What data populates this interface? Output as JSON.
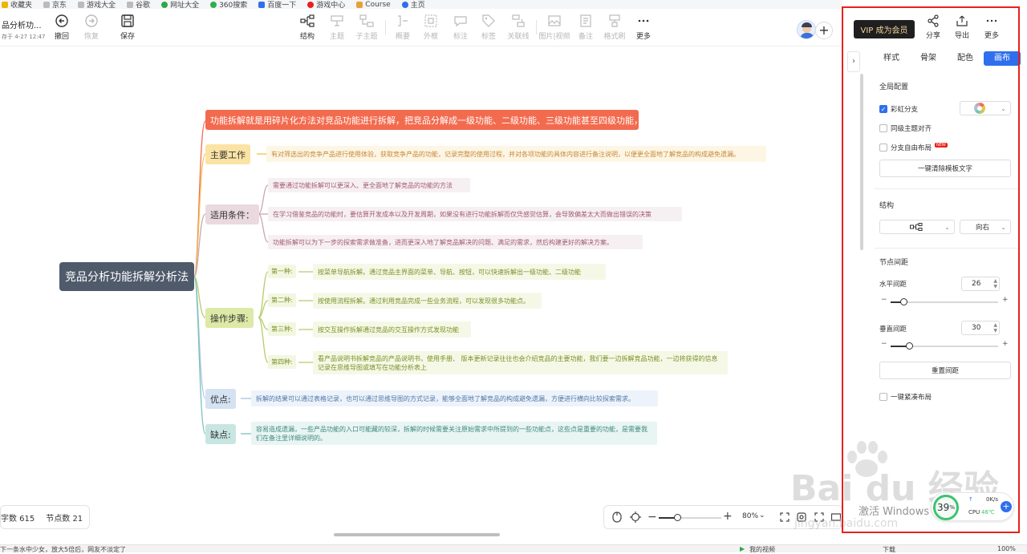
{
  "bookmarks": [
    "收藏夹",
    "京东",
    "游戏大全",
    "谷歌",
    "网址大全",
    "360搜索",
    "百度一下",
    "游戏中心",
    "Course",
    "主页"
  ],
  "doc": {
    "title": "品分析功...",
    "time": "存于 4-27 12:47"
  },
  "toolbar": {
    "undo": "撤回",
    "redo": "恢复",
    "save": "保存",
    "structure": "结构",
    "topic": "主题",
    "subtopic": "子主题",
    "summary": "概要",
    "frame": "外框",
    "annotation": "标注",
    "tag": "标签",
    "link": "关联线",
    "image_video": "图片|视频",
    "note": "备注",
    "format_brush": "格式刷",
    "more": "更多"
  },
  "mindmap": {
    "root": "竞品分析功能拆解分析法",
    "headline": "功能拆解就是用碎片化方法对竞品功能进行拆解，把竞品分解成一级功能、二级功能、三级功能甚至四级功能，",
    "main_work": {
      "label": "主要工作",
      "text": "有对筛选出的竞争产品进行使用体验，获取竞争产品的功能，记录完整的使用过程，并对各项功能的具体内容进行备注说明，以便更全面地了解竞品的构成避免遗漏。"
    },
    "conditions": {
      "label": "适用条件：",
      "items": [
        "需要通过功能拆解可以更深入、更全面地了解竞品的功能的方法",
        "在学习借鉴竞品的功能时，要估算开发成本以及开发周期，如果没有进行功能拆解而仅凭感觉估算，会导致偏差太大而做出错误的决策",
        "功能拆解可以为下一步的探索需求做准备，进而更深入地了解竞品解决的问题、满足的需求，然后构建更好的解决方案。"
      ]
    },
    "steps": {
      "label": "操作步骤:",
      "items": [
        {
          "tag": "第一种:",
          "text": "按菜单导航拆解。通过竞品主界面的菜单、导航、按钮，可以快速拆解出一级功能、二级功能"
        },
        {
          "tag": "第二种:",
          "text": "按使用流程拆解。通过利用竞品完成一些业务流程，可以发现很多功能点。"
        },
        {
          "tag": "第三种:",
          "text": "按交互操作拆解通过竞品的交互操作方式发现功能"
        },
        {
          "tag": "第四种:",
          "text": "看产品说明书拆解竞品的产品说明书，使用手册、 版本更新记录往往也会介绍竞品的主要功能，我们要一边拆解竞品功能，一边将获得的信息记录在思维导图或填写在功能分析表上"
        }
      ]
    },
    "pros": {
      "label": "优点:",
      "text": "拆解的结果可以通过表格记录，也可以通过思维导图的方式记录，能够全面地了解竞品的构成避免遗漏，方便进行横向比较探索需求。"
    },
    "cons": {
      "label": "缺点:",
      "text": "容易造成遗漏，一些产品功能的入口可能藏的较深，拆解的时候需要关注原始需求中所提到的一些功能点，这些点是重要的功能，是需要我们在备注里详细说明的。"
    }
  },
  "canvas_footer": {
    "word_count": "字数 615",
    "node_count": "节点数 21",
    "zoom": "80%",
    "zoom_level": 0.3
  },
  "panel": {
    "vip": "VIP 成为会员",
    "share": "分享",
    "export": "导出",
    "more": "更多",
    "tabs": [
      "样式",
      "骨架",
      "配色",
      "画布"
    ],
    "active_tab": 3,
    "global_config": "全局配置",
    "rainbow": "彩虹分支",
    "same_level_align": "同级主题对齐",
    "free_layout": "分支自由布局",
    "new_badge": "NEW",
    "clear_template": "一键清除模板文字",
    "structure_title": "结构",
    "direction": "向右",
    "spacing_title": "节点间距",
    "h_spacing_label": "水平间距",
    "h_spacing": "26",
    "h_spacing_level": 0.12,
    "v_spacing_label": "垂直间距",
    "v_spacing": "30",
    "v_spacing_level": 0.17,
    "reset_spacing": "重置间距",
    "compact": "一键紧凑布局"
  },
  "overlay": {
    "activate": "激活 Windows",
    "cpu": {
      "pct": "39",
      "unit": "%",
      "speed": "0K/s",
      "label": "CPU",
      "temp": "46℃"
    }
  },
  "statusbar": {
    "left": "下一条水中少女，放大5倍后，网友不淡定了",
    "video": "我的视频",
    "download": "下载",
    "zoom": "100%"
  },
  "colors": {
    "accent": "#2f6fed",
    "headline": "#f36b4f",
    "red_box": "#e8211c"
  }
}
